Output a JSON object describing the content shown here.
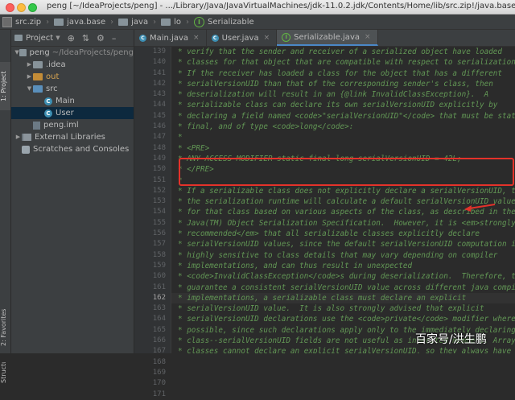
{
  "window": {
    "title": "peng [~/IdeaProjects/peng] - .../Library/Java/JavaVirtualMachines/jdk-11.0.2.jdk/Contents/Home/lib/src.zip!/java.base"
  },
  "breadcrumb": [
    "src.zip",
    "java.base",
    "java",
    "lo",
    "Serializable"
  ],
  "toolstrip": {
    "project_tab": "1: Project",
    "favorites_tab": "2: Favorites",
    "structure_tab": "Structure"
  },
  "project_panel": {
    "title": "Project",
    "tree": [
      {
        "label": "peng",
        "suffix": "~/IdeaProjects/peng",
        "icon": "folder-icon",
        "depth": 0,
        "expanded": true
      },
      {
        "label": ".idea",
        "icon": "folder-icon",
        "depth": 1,
        "expanded": false
      },
      {
        "label": "out",
        "icon": "excluded-folder-icon",
        "depth": 1,
        "expanded": false
      },
      {
        "label": "src",
        "icon": "source-folder-icon",
        "depth": 1,
        "expanded": true
      },
      {
        "label": "Main",
        "icon": "class-icon",
        "depth": 2
      },
      {
        "label": "User",
        "icon": "class-icon",
        "depth": 2,
        "selected": true
      },
      {
        "label": "peng.iml",
        "icon": "module-file-icon",
        "depth": 1
      },
      {
        "label": "External Libraries",
        "icon": "library-icon",
        "depth": 0,
        "expanded": false
      },
      {
        "label": "Scratches and Consoles",
        "icon": "scratches-icon",
        "depth": 0
      }
    ]
  },
  "editor": {
    "tabs": [
      {
        "label": "Main.java",
        "active": false
      },
      {
        "label": "User.java",
        "active": false
      },
      {
        "label": "Serializable.java",
        "active": true
      }
    ],
    "lines": [
      {
        "n": "139",
        "text": "* verify that the sender and receiver of a serialized object have loaded"
      },
      {
        "n": "140",
        "text": "* classes for that object that are compatible with respect to serialization."
      },
      {
        "n": "141",
        "text": "* If the receiver has loaded a class for the object that has a different"
      },
      {
        "n": "142",
        "text": "* serialVersionUID than that of the corresponding sender's class, then"
      },
      {
        "n": "143",
        "text": "* deserialization will result in an {@link InvalidClassException}.  A"
      },
      {
        "n": "144",
        "text": "* serializable class can declare its own serialVersionUID explicitly by"
      },
      {
        "n": "145",
        "text": "* declaring a field named <code>\"serialVersionUID\"</code> that must be static,"
      },
      {
        "n": "146",
        "text": "* final, and of type <code>long</code>:"
      },
      {
        "n": "147",
        "text": "*"
      },
      {
        "n": "148",
        "text": "* <PRE>"
      },
      {
        "n": "149",
        "text": "* ANY-ACCESS-MODIFIER static final long serialVersionUID = 42L;"
      },
      {
        "n": "150",
        "text": "* </PRE>"
      },
      {
        "n": "151",
        "text": "*"
      },
      {
        "n": "152",
        "text": "* If a serializable class does not explicitly declare a serialVersionUID, then"
      },
      {
        "n": "153",
        "text": "* the serialization runtime will calculate a default serialVersionUID value"
      },
      {
        "n": "154",
        "text": "* for that class based on various aspects of the class, as described in the"
      },
      {
        "n": "155",
        "text": "* Java(TM) Object Serialization Specification.  However, it is <em>strongly"
      },
      {
        "n": "156",
        "text": "* recommended</em> that all serializable classes explicitly declare"
      },
      {
        "n": "157",
        "text": "* serialVersionUID values, since the default serialVersionUID computation is"
      },
      {
        "n": "158",
        "text": "* highly sensitive to class details that may vary depending on compiler"
      },
      {
        "n": "159",
        "text": "* implementations, and can thus result in unexpected"
      },
      {
        "n": "160",
        "text": "* <code>InvalidClassException</code>s during deserialization.  Therefore, to"
      },
      {
        "n": "161",
        "text": "* guarantee a consistent serialVersionUID value across different java compiler"
      },
      {
        "n": "162",
        "text": "* implementations, a serializable class must declare an explicit"
      },
      {
        "n": "163",
        "text": "* serialVersionUID value.  It is also strongly advised that explicit"
      },
      {
        "n": "164",
        "text": "* serialVersionUID declarations use the <code>private</code> modifier where"
      },
      {
        "n": "165",
        "text": "* possible, since such declarations apply only to the immediately declaring"
      },
      {
        "n": "166",
        "text": "* class--serialVersionUID fields are not useful as inherited members. Array"
      },
      {
        "n": "167",
        "text": "* classes cannot declare an explicit serialVersionUID, so they always have"
      },
      {
        "n": "168",
        "text": "* the default computed value, but the requirement for matching"
      },
      {
        "n": "169",
        "text": "* serialVersionUID values is waived for array classes."
      },
      {
        "n": "170",
        "text": "*"
      },
      {
        "n": "171",
        "text": "* @author  unascribed"
      }
    ],
    "current_line": "162"
  },
  "watermark": "百家号/洪生鹏",
  "colors": {
    "comment": "#629755",
    "annotation_box": "#e4322a",
    "active_tab_underline": "#4a88c7"
  }
}
